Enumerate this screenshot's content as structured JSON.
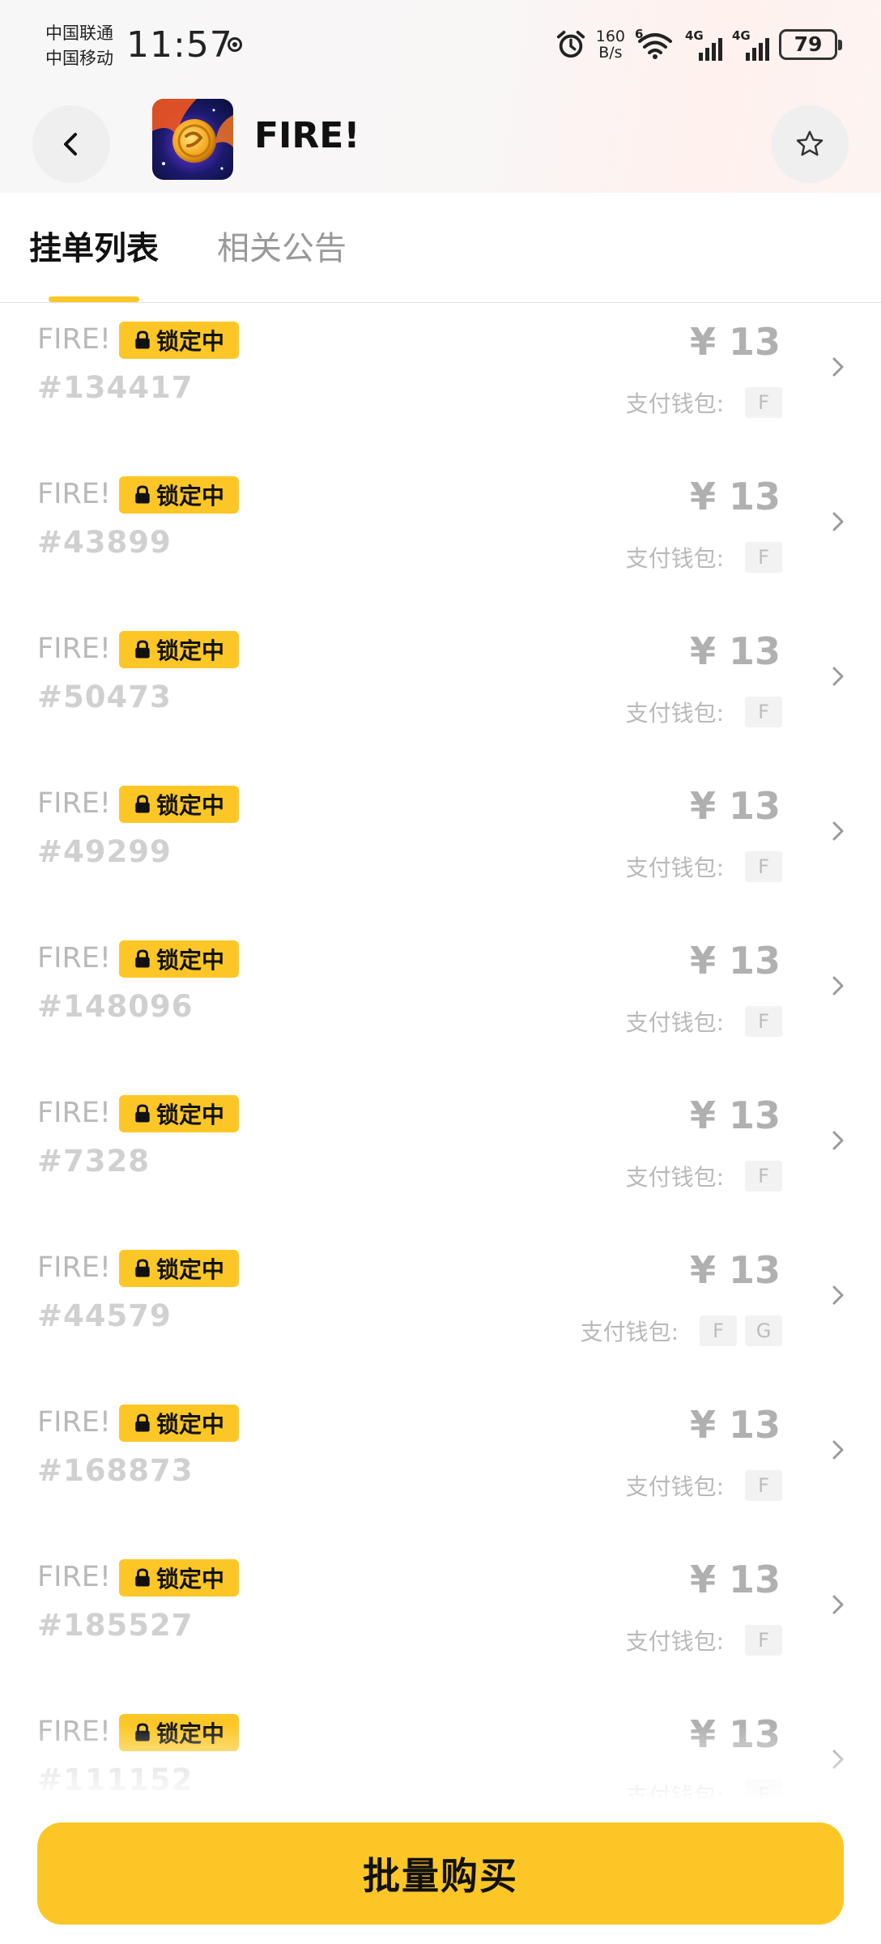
{
  "status_bar": {
    "carrier_1": "中国联通",
    "carrier_2": "中国移动",
    "time": "11:57",
    "net_speed_value": "160",
    "net_speed_unit": "B/s",
    "wifi_label": "6",
    "signal_1_label": "4G",
    "signal_2_label": "4G",
    "battery": "79"
  },
  "header": {
    "title": "FIRE!",
    "back_icon": "chevron-left-icon",
    "favorite_icon": "star-outline-icon"
  },
  "tabs": [
    {
      "label": "挂单列表",
      "active": true
    },
    {
      "label": "相关公告",
      "active": false
    }
  ],
  "listings": [
    {
      "name": "FIRE!",
      "badge": "锁定中",
      "number": "#134417",
      "price": "¥ 13",
      "wallet_label": "支付钱包:",
      "wallets": [
        "F"
      ]
    },
    {
      "name": "FIRE!",
      "badge": "锁定中",
      "number": "#43899",
      "price": "¥ 13",
      "wallet_label": "支付钱包:",
      "wallets": [
        "F"
      ]
    },
    {
      "name": "FIRE!",
      "badge": "锁定中",
      "number": "#50473",
      "price": "¥ 13",
      "wallet_label": "支付钱包:",
      "wallets": [
        "F"
      ]
    },
    {
      "name": "FIRE!",
      "badge": "锁定中",
      "number": "#49299",
      "price": "¥ 13",
      "wallet_label": "支付钱包:",
      "wallets": [
        "F"
      ]
    },
    {
      "name": "FIRE!",
      "badge": "锁定中",
      "number": "#148096",
      "price": "¥ 13",
      "wallet_label": "支付钱包:",
      "wallets": [
        "F"
      ]
    },
    {
      "name": "FIRE!",
      "badge": "锁定中",
      "number": "#7328",
      "price": "¥ 13",
      "wallet_label": "支付钱包:",
      "wallets": [
        "F"
      ]
    },
    {
      "name": "FIRE!",
      "badge": "锁定中",
      "number": "#44579",
      "price": "¥ 13",
      "wallet_label": "支付钱包:",
      "wallets": [
        "F",
        "G"
      ]
    },
    {
      "name": "FIRE!",
      "badge": "锁定中",
      "number": "#168873",
      "price": "¥ 13",
      "wallet_label": "支付钱包:",
      "wallets": [
        "F"
      ]
    },
    {
      "name": "FIRE!",
      "badge": "锁定中",
      "number": "#185527",
      "price": "¥ 13",
      "wallet_label": "支付钱包:",
      "wallets": [
        "F"
      ]
    },
    {
      "name": "FIRE!",
      "badge": "锁定中",
      "number": "#111152",
      "price": "¥ 13",
      "wallet_label": "支付钱包:",
      "wallets": [
        "F"
      ]
    }
  ],
  "bottom": {
    "buy_label": "批量购买"
  },
  "colors": {
    "accent": "#fcc726",
    "muted_text": "#b9b9b9",
    "number_text": "#d0d0d0"
  }
}
